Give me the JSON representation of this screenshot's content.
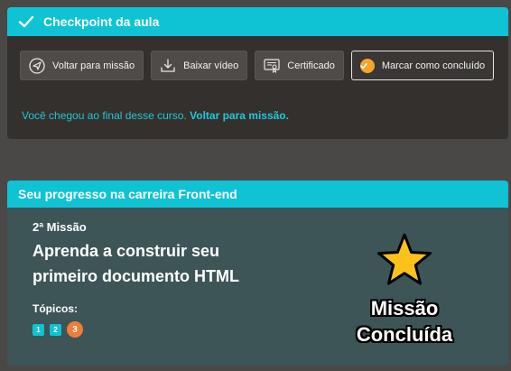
{
  "checkpoint": {
    "title": "Checkpoint da aula",
    "buttons": {
      "back": "Voltar para missão",
      "download": "Baixar vídeo",
      "certificate": "Certificado",
      "complete": "Marcar como concluído"
    },
    "end_message": "Você chegou ao final desse curso.",
    "end_link": "Voltar para missão."
  },
  "progress": {
    "title": "Seu progresso na carreira Front-end",
    "mission_number": "2ª Missão",
    "mission_title": "Aprenda a construir seu primeiro documento HTML",
    "topics_label": "Tópicos:",
    "topics": [
      "1",
      "2",
      "3"
    ],
    "status_line1": "Missão",
    "status_line2": "Concluída"
  },
  "colors": {
    "accent": "#0fc3d4",
    "check_orange": "#f4a52a",
    "current_topic": "#f07d3a",
    "star": "#fcc21b"
  },
  "icons": {
    "header": "check-icon",
    "back": "send-icon",
    "download": "download-icon",
    "certificate": "certificate-icon",
    "complete": "check-circle-icon",
    "status": "star-icon"
  }
}
